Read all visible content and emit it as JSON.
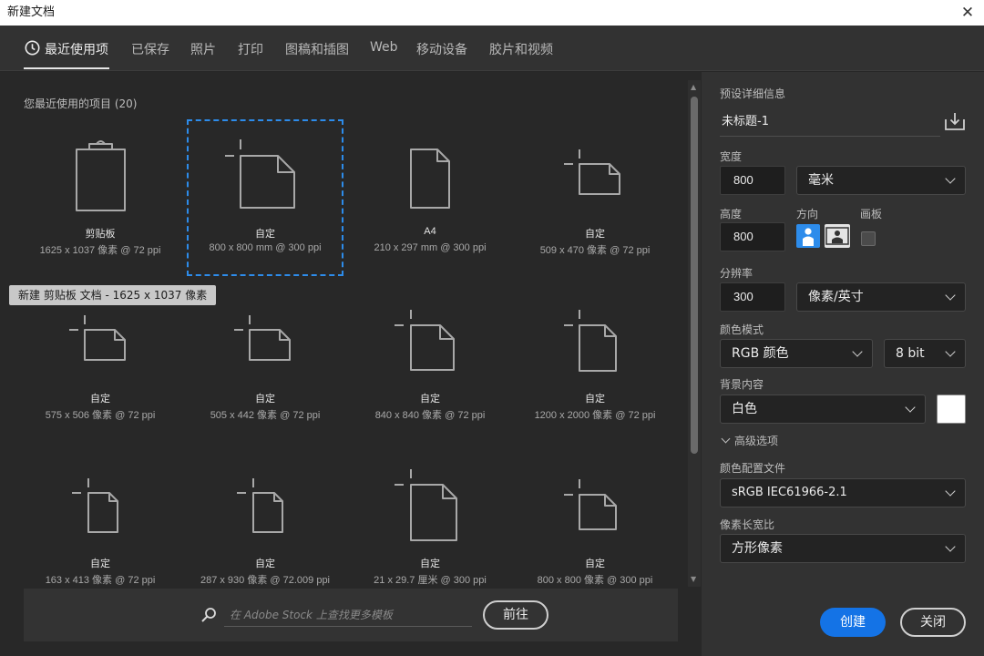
{
  "window": {
    "title": "新建文档",
    "close_glyph": "✕"
  },
  "tabs": [
    {
      "label": "最近使用项",
      "icon": "clock-icon",
      "active": true
    },
    {
      "label": "已保存"
    },
    {
      "label": "照片"
    },
    {
      "label": "打印"
    },
    {
      "label": "图稿和插图"
    },
    {
      "label": "Web"
    },
    {
      "label": "移动设备"
    },
    {
      "label": "胶片和视频"
    }
  ],
  "recent": {
    "heading": "您最近使用的项目",
    "count": "(20)",
    "items": [
      {
        "name": "剪贴板",
        "meta": "1625 x 1037 像素 @ 72 ppi",
        "icon": "clipboard-icon"
      },
      {
        "name": "自定",
        "meta": "800 x 800 mm @ 300 ppi",
        "icon": "custom-document-icon",
        "selected": true
      },
      {
        "name": "A4",
        "meta": "210 x 297 mm @ 300 ppi",
        "icon": "document-icon"
      },
      {
        "name": "自定",
        "meta": "509 x 470 像素 @ 72 ppi",
        "icon": "custom-landscape-icon"
      },
      {
        "name": "自定",
        "meta": "575 x 506 像素 @ 72 ppi",
        "icon": "custom-landscape-icon"
      },
      {
        "name": "自定",
        "meta": "505 x 442 像素 @ 72 ppi",
        "icon": "custom-landscape-icon"
      },
      {
        "name": "自定",
        "meta": "840 x 840 像素 @ 72 ppi",
        "icon": "custom-portrait-icon"
      },
      {
        "name": "自定",
        "meta": "1200 x 2000 像素 @ 72 ppi",
        "icon": "custom-portrait-icon"
      },
      {
        "name": "自定",
        "meta": "163 x 413 像素 @ 72 ppi",
        "icon": "custom-small-portrait-icon"
      },
      {
        "name": "自定",
        "meta": "287 x 930 像素 @ 72.009 ppi",
        "icon": "custom-small-portrait-icon"
      },
      {
        "name": "自定",
        "meta": "21 x 29.7 厘米 @ 300 ppi",
        "icon": "custom-portrait-icon"
      },
      {
        "name": "自定",
        "meta": "800 x 800 像素 @ 300 ppi",
        "icon": "custom-landscape-icon"
      }
    ],
    "tooltip": "新建 剪贴板 文档 - 1625 x 1037 像素"
  },
  "stock": {
    "placeholder": "在 Adobe Stock 上查找更多模板",
    "go_label": "前往"
  },
  "preset": {
    "section_title": "预设详细信息",
    "doc_name": "未标题-1",
    "width_label": "宽度",
    "width_value": "800",
    "width_unit": "毫米",
    "height_label": "高度",
    "height_value": "800",
    "orientation_label": "方向",
    "artboard_label": "画板",
    "resolution_label": "分辨率",
    "resolution_value": "300",
    "resolution_unit": "像素/英寸",
    "color_mode_label": "颜色模式",
    "color_mode": "RGB 颜色",
    "bit_depth": "8 bit",
    "background_label": "背景内容",
    "background": "白色",
    "background_color": "#ffffff",
    "advanced_label": "高级选项",
    "color_profile_label": "颜色配置文件",
    "color_profile": "sRGB IEC61966-2.1",
    "pixel_aspect_label": "像素长宽比",
    "pixel_aspect": "方形像素"
  },
  "actions": {
    "create": "创建",
    "close": "关闭"
  },
  "colors": {
    "accent": "#1473e6",
    "selection": "#2d8ceb",
    "panel": "#323232",
    "canvas": "#282828"
  }
}
